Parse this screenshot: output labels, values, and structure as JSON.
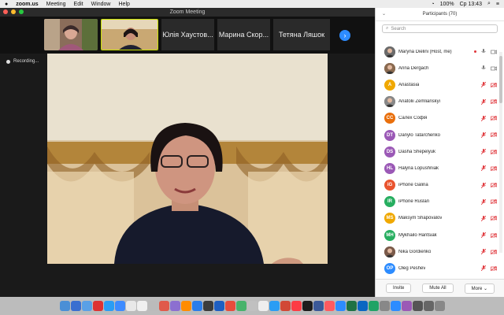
{
  "menubar": {
    "app": "zoom.us",
    "items": [
      "Meeting",
      "Edit",
      "Window",
      "Help"
    ],
    "battery": "100%",
    "clock": "Ср 13:43"
  },
  "window": {
    "title": "Zoom Meeting"
  },
  "thumbs": {
    "names": [
      "Юлія Хаустов...",
      "Марина Скор...",
      "Тетяна Ляшок"
    ]
  },
  "recording": {
    "label": "Recording..."
  },
  "participants": {
    "title": "Participants (70)",
    "search_placeholder": "Search",
    "list": [
      {
        "name": "Maryna Dielini (Host, me)",
        "initials": "",
        "color": "#6b6b6b",
        "photo": true,
        "muted": false
      },
      {
        "name": "Anna Dergach",
        "initials": "",
        "color": "#8a6a50",
        "photo": true,
        "muted": false
      },
      {
        "name": "Anastasia",
        "initials": "A",
        "color": "#f0a800",
        "photo": false,
        "muted": true
      },
      {
        "name": "Anatolii Zemlianskyi",
        "initials": "",
        "color": "#888",
        "photo": true,
        "muted": true
      },
      {
        "name": "Салех Софія",
        "initials": "CC",
        "color": "#e96f0c",
        "photo": false,
        "muted": true
      },
      {
        "name": "Danylo Tatarchenko",
        "initials": "DT",
        "color": "#9b59b6",
        "photo": false,
        "muted": true
      },
      {
        "name": "Dasha Shepelyuk",
        "initials": "DS",
        "color": "#9b59b6",
        "photo": false,
        "muted": true
      },
      {
        "name": "Halyna Lopushniak",
        "initials": "HL",
        "color": "#9b59b6",
        "photo": false,
        "muted": true
      },
      {
        "name": "iPhone Galina",
        "initials": "iG",
        "color": "#e9542f",
        "photo": false,
        "muted": true
      },
      {
        "name": "iPhone Ruslan",
        "initials": "IR",
        "color": "#27ae60",
        "photo": false,
        "muted": true
      },
      {
        "name": "Maksym Shapovalov",
        "initials": "MS",
        "color": "#f0a800",
        "photo": false,
        "muted": true
      },
      {
        "name": "Mykhailo Hantsiak",
        "initials": "MH",
        "color": "#27ae60",
        "photo": false,
        "muted": true
      },
      {
        "name": "Nika Gordienko",
        "initials": "",
        "color": "#7a5a4a",
        "photo": true,
        "muted": true
      },
      {
        "name": "Oleg Peshev",
        "initials": "OP",
        "color": "#2d8cff",
        "photo": false,
        "muted": true
      }
    ],
    "footer": {
      "invite": "Invite",
      "mute_all": "Mute All",
      "more": "More ⌄"
    }
  },
  "colors": {
    "accent": "#2d8cff",
    "muted_red": "#e0373c"
  }
}
